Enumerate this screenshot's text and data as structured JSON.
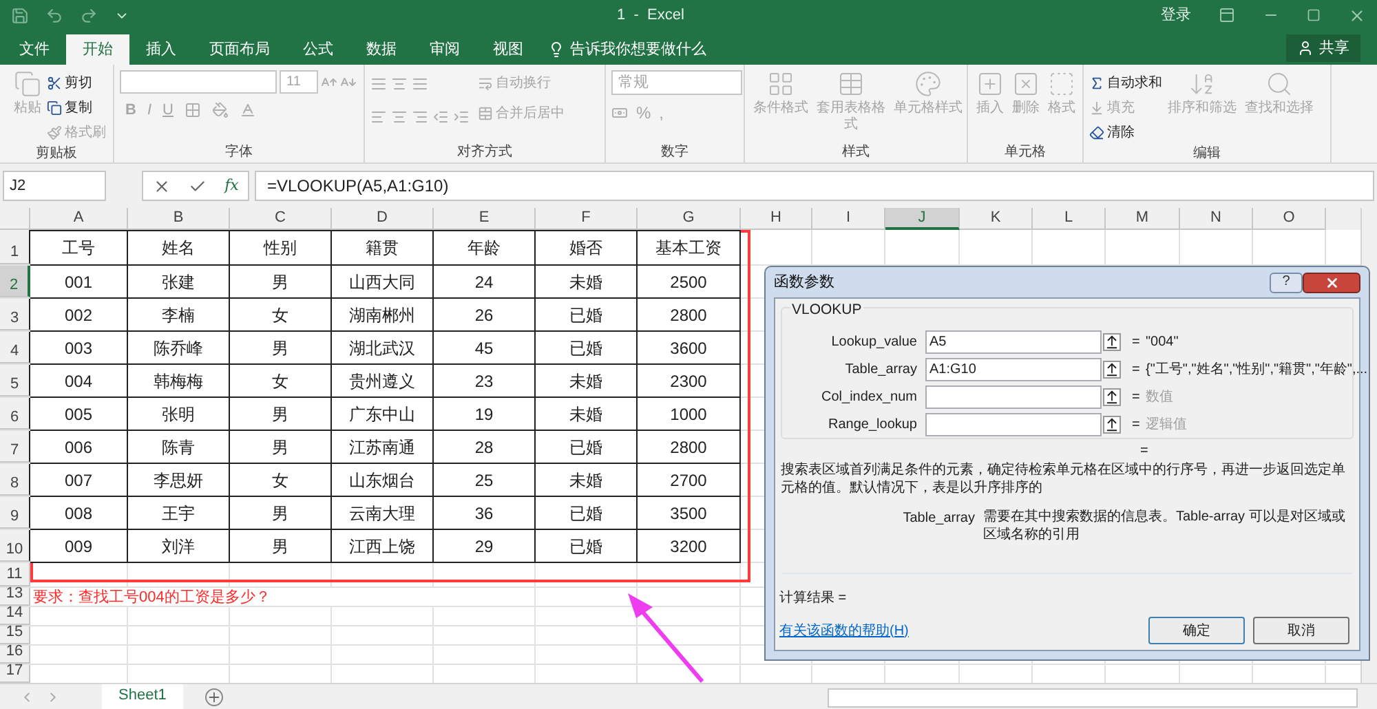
{
  "window": {
    "title": "1  -  Excel",
    "sign_in": "登录",
    "share": "共享"
  },
  "tabs": [
    {
      "label": "文件",
      "selected": false
    },
    {
      "label": "开始",
      "selected": true
    },
    {
      "label": "插入",
      "selected": false
    },
    {
      "label": "页面布局",
      "selected": false
    },
    {
      "label": "公式",
      "selected": false
    },
    {
      "label": "数据",
      "selected": false
    },
    {
      "label": "审阅",
      "selected": false
    },
    {
      "label": "视图",
      "selected": false
    }
  ],
  "tell_me": "告诉我你想要做什么",
  "ribbon": {
    "clipboard": {
      "label": "剪贴板",
      "paste": {
        "label": "粘贴",
        "disabled": true
      },
      "small": [
        {
          "label": "剪切",
          "disabled": false
        },
        {
          "label": "复制",
          "disabled": false
        },
        {
          "label": "格式刷",
          "disabled": true
        }
      ]
    },
    "font": {
      "label": "字体",
      "size": "11",
      "format_buttons": [
        "B",
        "I",
        "U"
      ]
    },
    "alignment": {
      "label": "对齐方式",
      "small": [
        {
          "label": "自动换行",
          "disabled": true
        },
        {
          "label": "合并后居中",
          "disabled": true
        }
      ]
    },
    "number": {
      "label": "数字",
      "format": "常规",
      "symbols": [
        "%",
        ","
      ]
    },
    "styles": {
      "label": "样式",
      "large": [
        {
          "label": "条件格式",
          "disabled": true
        },
        {
          "label": "套用表格格式",
          "disabled": true
        },
        {
          "label": "单元格样式",
          "disabled": true
        }
      ]
    },
    "cells": {
      "label": "单元格",
      "large": [
        {
          "label": "插入",
          "disabled": true
        },
        {
          "label": "删除",
          "disabled": true
        },
        {
          "label": "格式",
          "disabled": true
        }
      ]
    },
    "editing": {
      "label": "编辑",
      "small": [
        {
          "label": "自动求和",
          "disabled": false
        },
        {
          "label": "填充",
          "disabled": true
        },
        {
          "label": "清除",
          "disabled": false
        }
      ],
      "large": [
        {
          "label": "排序和筛选",
          "disabled": true
        },
        {
          "label": "查找和选择",
          "disabled": true
        }
      ]
    }
  },
  "formula_bar": {
    "name_box": "J2",
    "function_button": "fx",
    "formula": "=VLOOKUP(A5,A1:G10)"
  },
  "grid": {
    "columns": [
      {
        "letter": "A",
        "selected": false
      },
      {
        "letter": "B",
        "selected": false
      },
      {
        "letter": "C",
        "selected": false
      },
      {
        "letter": "D",
        "selected": false
      },
      {
        "letter": "E",
        "selected": false
      },
      {
        "letter": "F",
        "selected": false
      },
      {
        "letter": "G",
        "selected": false
      },
      {
        "letter": "H",
        "selected": false
      },
      {
        "letter": "I",
        "selected": false
      },
      {
        "letter": "J",
        "selected": true
      },
      {
        "letter": "K",
        "selected": false
      },
      {
        "letter": "L",
        "selected": false
      },
      {
        "letter": "M",
        "selected": false
      },
      {
        "letter": "N",
        "selected": false
      },
      {
        "letter": "O",
        "selected": false
      }
    ],
    "rows": [
      {
        "number": "1",
        "selected": false
      },
      {
        "number": "2",
        "selected": true
      },
      {
        "number": "3",
        "selected": false
      },
      {
        "number": "4",
        "selected": false
      },
      {
        "number": "5",
        "selected": false
      },
      {
        "number": "6",
        "selected": false
      },
      {
        "number": "7",
        "selected": false
      },
      {
        "number": "8",
        "selected": false
      },
      {
        "number": "9",
        "selected": false
      },
      {
        "number": "10",
        "selected": false
      },
      {
        "number": "11",
        "selected": false
      },
      {
        "number": "13",
        "selected": false
      },
      {
        "number": "14",
        "selected": false
      },
      {
        "number": "15",
        "selected": false
      },
      {
        "number": "16",
        "selected": false
      },
      {
        "number": "17",
        "selected": false
      }
    ]
  },
  "table": {
    "header": [
      "工号",
      "姓名",
      "性别",
      "籍贯",
      "年龄",
      "婚否",
      "基本工资"
    ],
    "rows": [
      [
        "001",
        "张建",
        "男",
        "山西大同",
        "24",
        "未婚",
        "2500"
      ],
      [
        "002",
        "李楠",
        "女",
        "湖南郴州",
        "26",
        "已婚",
        "2800"
      ],
      [
        "003",
        "陈乔峰",
        "男",
        "湖北武汉",
        "45",
        "已婚",
        "3600"
      ],
      [
        "004",
        "韩梅梅",
        "女",
        "贵州遵义",
        "23",
        "未婚",
        "2300"
      ],
      [
        "005",
        "张明",
        "男",
        "广东中山",
        "19",
        "未婚",
        "1000"
      ],
      [
        "006",
        "陈青",
        "男",
        "江苏南通",
        "28",
        "已婚",
        "2800"
      ],
      [
        "007",
        "李思妍",
        "女",
        "山东烟台",
        "25",
        "未婚",
        "2700"
      ],
      [
        "008",
        "王宇",
        "男",
        "云南大理",
        "36",
        "已婚",
        "3500"
      ],
      [
        "009",
        "刘洋",
        "男",
        "江西上饶",
        "29",
        "已婚",
        "3200"
      ]
    ]
  },
  "note": "要求：查找工号004的工资是多少？",
  "dialog": {
    "title": "函数参数",
    "help_button": "?",
    "function": "VLOOKUP",
    "args": [
      {
        "label": "Lookup_value",
        "value": "A5",
        "equals": "=",
        "result": "\"004\"",
        "muted": false
      },
      {
        "label": "Table_array",
        "value": "A1:G10",
        "equals": "=",
        "result": "{\"工号\",\"姓名\",\"性别\",\"籍贯\",\"年龄\",...",
        "muted": false
      },
      {
        "label": "Col_index_num",
        "equals": "=",
        "result": "数值",
        "muted": true
      },
      {
        "label": "Range_lookup",
        "equals": "=",
        "result": "逻辑值",
        "muted": true
      }
    ],
    "formula_result": "=",
    "description": "搜索表区域首列满足条件的元素，确定待检索单元格在区域中的行序号，再进一步返回选定单元格的值。默认情况下，表是以升序排序的",
    "arg_name": "Table_array",
    "arg_description": "需要在其中搜索数据的信息表。Table-array 可以是对区域或区域名称的引用",
    "calc_result": "计算结果 =",
    "help_link": "有关该函数的帮助(H)",
    "ok": "确定",
    "cancel": "取消"
  },
  "sheets": [
    {
      "name": "Sheet1",
      "selected": true
    }
  ]
}
